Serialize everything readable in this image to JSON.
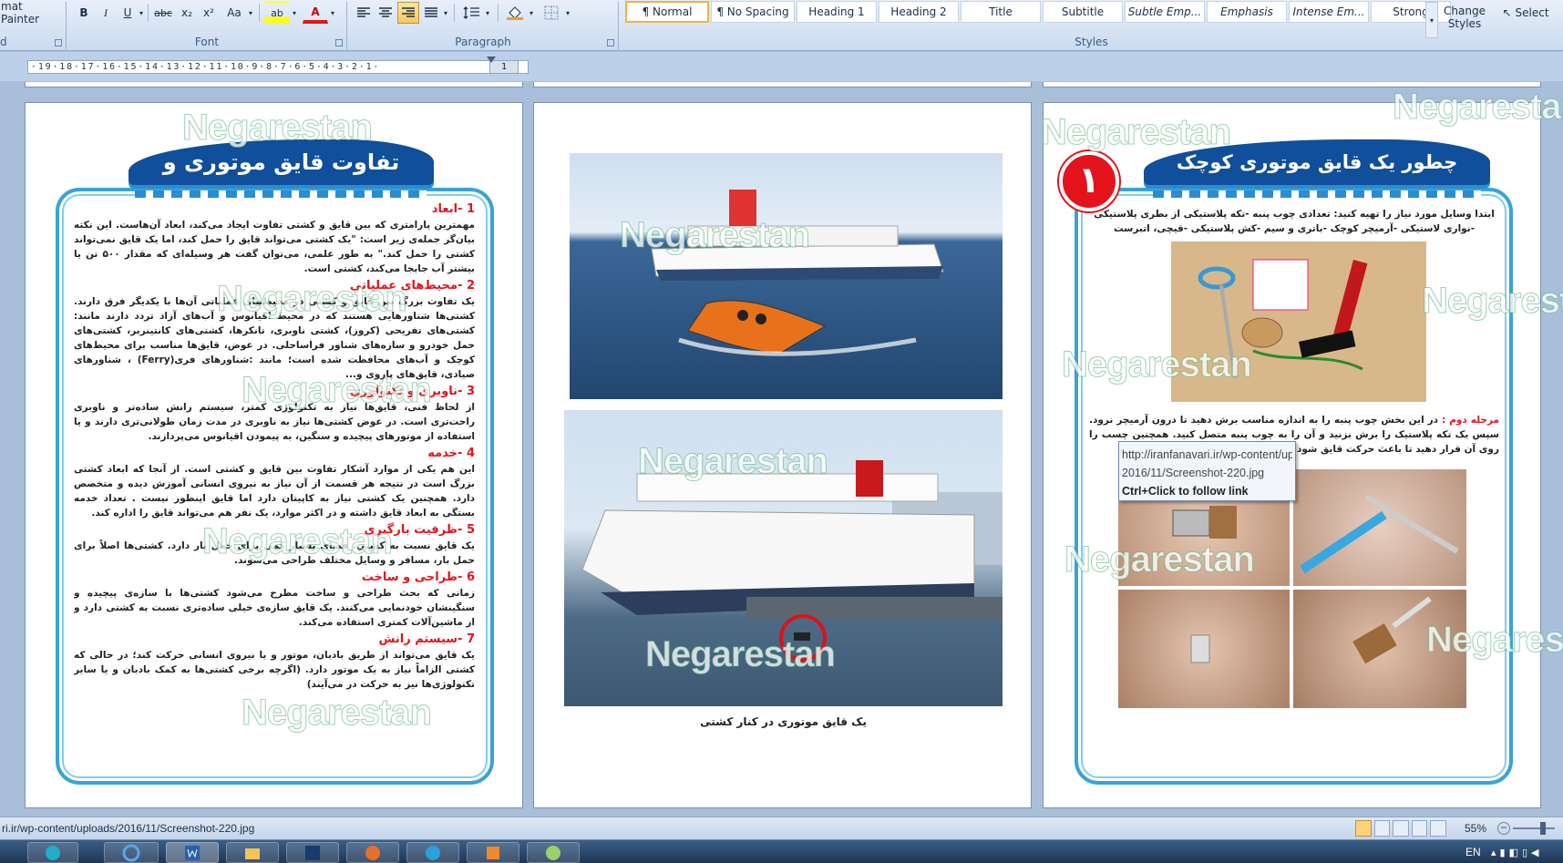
{
  "ribbon": {
    "clipboard": {
      "format_painter": "mat Painter",
      "label": "d"
    },
    "font": {
      "label": "Font",
      "bold": "B",
      "italic": "I",
      "underline": "U",
      "strike": "abc",
      "subscript": "x₂",
      "superscript": "x²",
      "change_case": "Aa",
      "highlight": "ab",
      "font_color": "A"
    },
    "paragraph": {
      "label": "Paragraph"
    },
    "styles": {
      "label": "Styles",
      "items": [
        "¶ Normal",
        "¶ No Spacing",
        "Heading 1",
        "Heading 2",
        "Title",
        "Subtitle",
        "Subtle Emp...",
        "Emphasis",
        "Intense Em...",
        "Strong"
      ],
      "change_styles": [
        "Change",
        "Styles"
      ],
      "select": "Select"
    }
  },
  "ruler": {
    "text": "·19·18·17·16·15·14·13·12·11·10·9·8·7·6·5·4·3·2·1·",
    "end": "1"
  },
  "page_left": {
    "title": "تفاوت قایق موتوری و کشتی",
    "sections": [
      {
        "heading": "1 -ابعاد",
        "body": "مهمترین پارامتری که بین قایق و کشتی تفاوت ایجاد می‌کند، ابعاد آن‌هاست. این نکته بیان‌گر جمله‌ی زیر است: \"یک کشتی می‌تواند قایق را حمل کند، اما یک قایق نمی‌تواند کشتی را حمل کند.\" به طور علمی، می‌توان گفت هر وسیله‌ای که مقدار ۵۰۰ تن یا بیشتر آب جابجا می‌کند، کشتی است."
      },
      {
        "heading": "2 -محیط‌های عملیاتی",
        "body": "یک تفاوت بزرگ بین قایق و کشتی در محیط‌های عملیاتی آن‌ها با یکدیگر فرق دارند. کشتی‌ها شناورهایی هستند که در محیط اقیانوس و آب‌های آزاد تردد دارند مانند: کشتی‌های تفریحی (کروز)، کشتی ناوبری، تانکرها، کشتی‌های کانتینربر، کشتی‌های حمل خودرو و سازه‌های شناور فراساحلی. در عوض، قایق‌ها مناسب برای محیط‌های کوچک و آب‌های محافظت شده است؛ مانند :شناورهای فری(Ferry) ، شناورهای صیادی، قایق‌های پاروی و..."
      },
      {
        "heading": "3 -ناوبری و تکنولوژی",
        "body": "از لحاظ فنی، قایق‌ها نیاز به تکنولوژی کمتر، سیستم رانش ساده‌تر و ناوبری راحت‌تری است. در عوض کشتی‌ها نیاز به ناوبری در مدت زمان طولانی‌تری دارند و یا استفاده از موتورهای پیچیده و سنگین، به پیمودن اقیانوس می‌پردازند."
      },
      {
        "heading": "4 -خدمه",
        "body": "این هم یکی از موارد آشکار تفاوت بین قایق و کشتی است. از آنجا که ابعاد کشتی بزرگ است در نتیجه هر قسمت از آن نیاز به نیروی انسانی آموزش دیده و متخصص دارد. همچنین یک کشتی نیاز به کاپیتان دارد اما قایق اینطور نیست . تعداد خدمه بستگی به ابعاد قایق داشته و در اکثر موارد، یک نفر هم می‌تواند قایق را اداره کند."
      },
      {
        "heading": "5 -ظرفیت بارگیری",
        "body": "یک قایق نسبت به کشتی، فضای بسیار کمی برای حمل بار دارد. کشتی‌ها اصلاً برای حمل بار، مسافر و وسایل مختلف طراحی می‌شوند."
      },
      {
        "heading": "6 -طراحی و ساخت",
        "body": "زمانی که بحث طراحی و ساخت مطرح می‌شود کشتی‌ها با سازه‌ی پیچیده و سنگینشان خودنمایی می‌کنند. یک قایق سازه‌ی خیلی ساده‌تری نسبت به کشتی دارد و از ماشین‌آلات کمتری استفاده می‌کند."
      },
      {
        "heading": "7 -سیستم رانش",
        "body": "یک قایق می‌تواند از طریق بادبان، موتور و یا نیروی انسانی حرکت کند؛ در حالی که کشتی الزاماً نیاز به یک موتور دارد. (اگرچه برخی کشتی‌ها به کمک بادبان و یا سایر تکنولوژی‌ها نیز به حرکت در می‌آیند)"
      }
    ]
  },
  "page_middle": {
    "caption": "یک قایق موتوری در کنار کشتی"
  },
  "page_right": {
    "title": "چطور یک قایق موتوری کوچک بسازیم؟",
    "badge": "۱",
    "intro": "ابتدا وسایل مورد نیاز را تهیه کنید: تعدادی چوب پنبه -تکه پلاستیکی از بطری پلاستیکی -نواری لاستیکی -آرمیچر کوچک -باتری و سیم -کش پلاستیکی -قیچی، اتبرست",
    "step2_label": "مرحله دوم :",
    "step2_text": "در این بخش چوب پنبه را به اندازه مناسب برش دهید تا درون آرمیچر نرود. سپس یک تکه پلاستیک را برش بزنید و آن را به چوب پنبه متصل کنید. همچنین چسب را روی آن قرار دهید تا باعث حرکت قایق شود."
  },
  "tooltip": {
    "url_line1": "http://iranfanavari.ir/wp-content/uploads/",
    "url_line2": "2016/11/Screenshot-220.jpg",
    "hint": "Ctrl+Click to follow link"
  },
  "watermark": "Negarestan",
  "status": {
    "path": "ri.ir/wp-content/uploads/2016/11/Screenshot-220.jpg",
    "zoom": "55%"
  },
  "taskbar": {
    "lang": "EN"
  }
}
